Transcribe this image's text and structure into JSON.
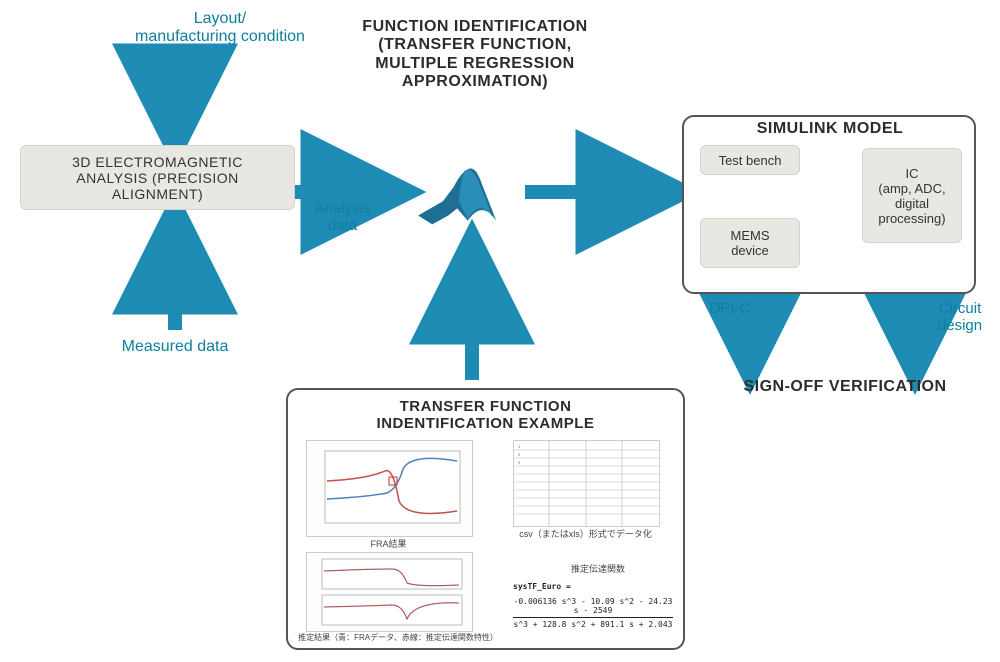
{
  "inputs": {
    "layout_condition": "Layout/\nmanufacturing condition",
    "measured_data": "Measured data"
  },
  "analysis_box": "3D ELECTROMAGNETIC\nANALYSIS (PRECISION ALIGNMENT)",
  "analysis_output_label": "Analysis\ndata",
  "function_id_title": "FUNCTION IDENTIFICATION\n(TRANSFER FUNCTION,\nMULTIPLE REGRESSION\nAPPROXIMATION)",
  "simulink": {
    "title": "SIMULINK MODEL",
    "test_bench": "Test bench",
    "mems": "MEMS\ndevice",
    "ic": "IC\n(amp, ADC,\ndigital\nprocessing)"
  },
  "outputs": {
    "dpi_c": "DPI-C",
    "circuit_design": "Circuit\ndesign",
    "sign_off": "SIGN-OFF VERIFICATION"
  },
  "example": {
    "title": "TRANSFER FUNCTION\nINDENTIFICATION EXAMPLE",
    "fra_label": "FRA結果",
    "csv_label": "csv（またはxls）形式でデータ化",
    "est_tf_label": "推定伝達関数",
    "est_result_label": "推定結果（青：FRAデータ、赤線：推定伝達関数特性）",
    "sys_name": "sysTF_Euro =",
    "numerator": "-0.006136 s^3 - 10.09 s^2 - 24.23 s - 2549",
    "denominator": "s^3 + 128.8 s^2 + 891.1 s + 2.043"
  }
}
